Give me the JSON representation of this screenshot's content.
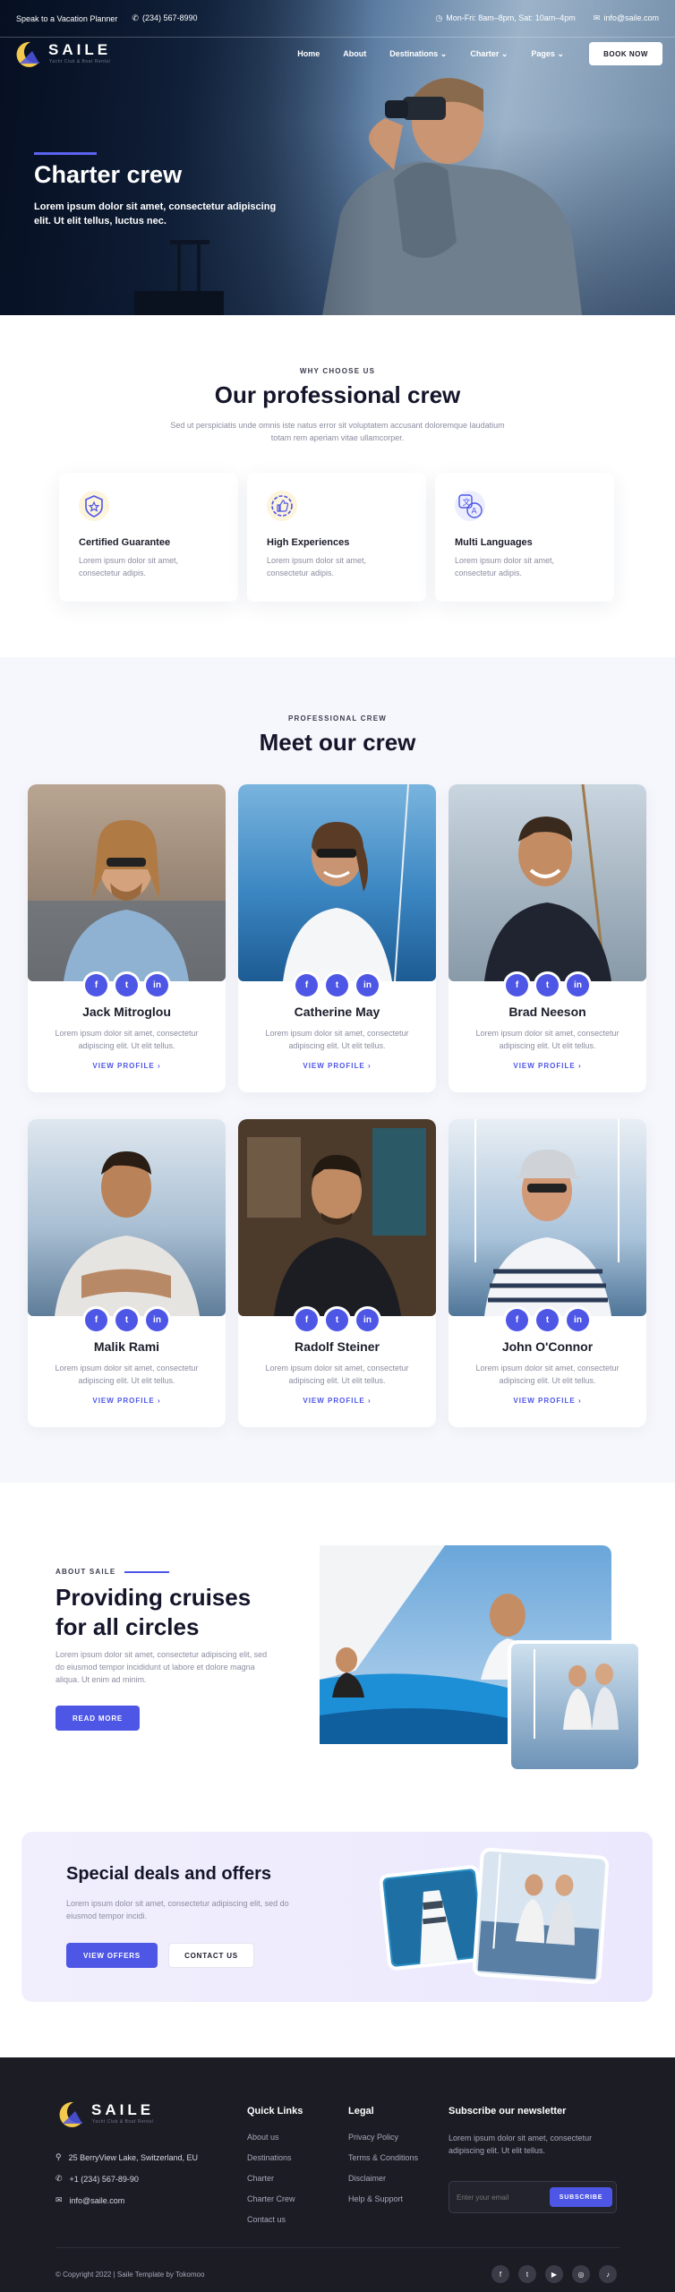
{
  "topbar": {
    "speak": "Speak to a Vacation Planner",
    "phone": "(234) 567-8990",
    "hours": "Mon-Fri: 8am–8pm, Sat: 10am–4pm",
    "email": "info@saile.com"
  },
  "brand": {
    "name": "SAILE",
    "tagline": "Yacht Club & Boat Rental"
  },
  "nav": {
    "items": [
      "Home",
      "About",
      "Destinations",
      "Charter",
      "Pages"
    ],
    "book": "BOOK NOW"
  },
  "hero": {
    "title": "Charter crew",
    "text": "Lorem ipsum dolor sit amet, consectetur adipiscing elit. Ut elit tellus, luctus nec."
  },
  "why": {
    "eyebrow": "WHY CHOOSE US",
    "title": "Our professional crew",
    "text": "Sed ut perspiciatis unde omnis iste natus error sit voluptatem accusant doloremque laudatium totam rem aperiam vitae ullamcorper.",
    "features": [
      {
        "title": "Certified Guarantee",
        "text": "Lorem ipsum dolor sit amet, consectetur adipis.",
        "icon": "shield-star-icon"
      },
      {
        "title": "High Experiences",
        "text": "Lorem ipsum dolor sit amet, consectetur adipis.",
        "icon": "thumbs-up-badge-icon"
      },
      {
        "title": "Multi Languages",
        "text": "Lorem ipsum dolor sit amet, consectetur adipis.",
        "icon": "translate-icon"
      }
    ]
  },
  "crew": {
    "eyebrow": "PROFESSIONAL CREW",
    "title": "Meet our crew",
    "desc": "Lorem ipsum dolor sit amet, consectetur adipiscing elit. Ut elit tellus.",
    "link": "VIEW PROFILE",
    "social": [
      "f",
      "t",
      "in"
    ],
    "members": [
      "Jack Mitroglou",
      "Catherine May",
      "Brad Neeson",
      "Malik Rami",
      "Radolf Steiner",
      "John O'Connor"
    ]
  },
  "about": {
    "eyebrow": "ABOUT SAILE",
    "title1": "Providing cruises",
    "title2": "for all circles",
    "text": "Lorem ipsum dolor sit amet, consectetur adipiscing elit, sed do eiusmod tempor incididunt ut labore et dolore magna aliqua. Ut enim ad minim.",
    "button": "READ MORE"
  },
  "deals": {
    "title": "Special deals and offers",
    "text": "Lorem ipsum dolor sit amet, consectetur adipiscing elit, sed do eiusmod tempor incidi.",
    "primary": "VIEW OFFERS",
    "secondary": "CONTACT US"
  },
  "footer": {
    "address": "25 BerryView Lake, Switzerland, EU",
    "phone": "+1 (234) 567-89-90",
    "email": "info@saile.com",
    "quick": {
      "title": "Quick Links",
      "items": [
        "About us",
        "Destinations",
        "Charter",
        "Charter Crew",
        "Contact us"
      ]
    },
    "legal": {
      "title": "Legal",
      "items": [
        "Privacy Policy",
        "Terms & Conditions",
        "Disclaimer",
        "Help & Support"
      ]
    },
    "newsletter": {
      "title": "Subscribe our newsletter",
      "text": "Lorem ipsum dolor sit amet, consectetur adipiscing elit. Ut elit tellus.",
      "placeholder": "Enter your email",
      "button": "SUBSCRIBE"
    },
    "copyright": "© Copyright 2022 | Saile Template by Tokomoo",
    "social": [
      "f",
      "t",
      "▶",
      "◎",
      "♪"
    ]
  },
  "colors": {
    "accent": "#4e56e6",
    "dark": "#1b1c24",
    "gold": "#f2c94c"
  }
}
